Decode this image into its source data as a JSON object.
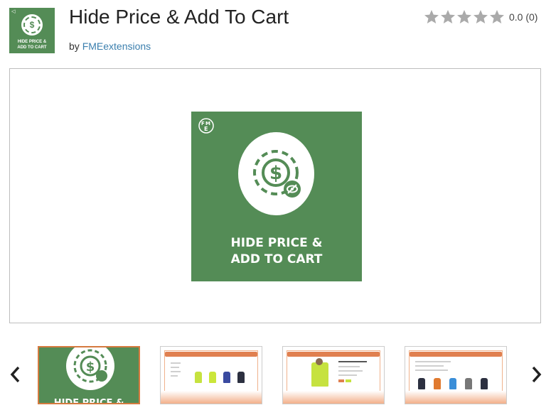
{
  "header": {
    "logo_caption_line1": "HIDE PRICE &",
    "logo_caption_line2": "ADD TO CART",
    "title": "Hide Price & Add To Cart",
    "by_prefix": "by",
    "author": "FMEextensions"
  },
  "rating": {
    "value": "0.0",
    "count": "(0)",
    "stars_filled": 0,
    "stars_total": 5,
    "star_color": "#aaaaaa"
  },
  "hero": {
    "caption_line1": "HIDE PRICE &",
    "caption_line2": "ADD TO CART",
    "bg_color": "#548c56"
  },
  "carousel": {
    "prev_icon": "chevron-left-icon",
    "next_icon": "chevron-right-icon",
    "thumbnails": [
      {
        "name": "thumbnail-1",
        "caption": "HIDE PRICE &",
        "active": true
      },
      {
        "name": "thumbnail-2",
        "active": false
      },
      {
        "name": "thumbnail-3",
        "active": false
      },
      {
        "name": "thumbnail-4",
        "active": false
      }
    ],
    "active_border_color": "#d57a3f"
  },
  "colors": {
    "brand_green": "#548c56",
    "link": "#3b7fae",
    "accent_orange": "#e08050"
  }
}
